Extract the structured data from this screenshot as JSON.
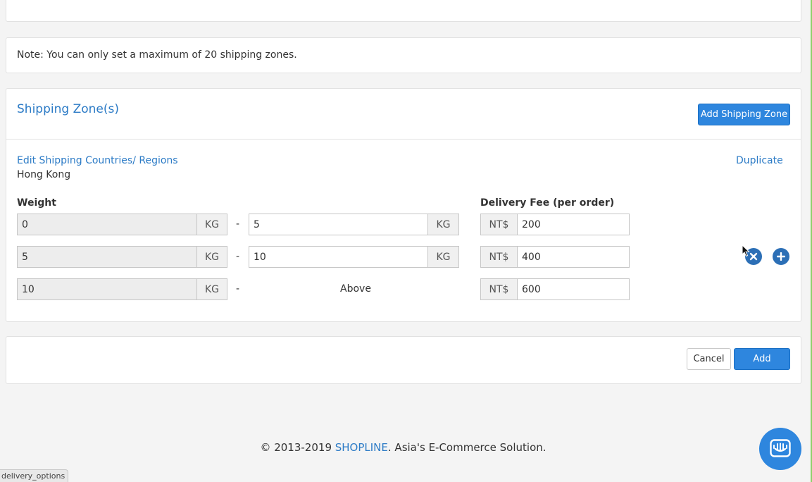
{
  "note": {
    "text": "Note: You can only set a maximum of 20 shipping zones."
  },
  "zones": {
    "title": "Shipping Zone(s)",
    "add_zone_label": "Add Shipping Zone",
    "zone": {
      "edit_link": "Edit Shipping Countries/ Regions",
      "region": "Hong Kong",
      "duplicate_label": "Duplicate",
      "weight_label": "Weight",
      "fee_label": "Delivery Fee (per order)",
      "unit": "KG",
      "dash": "-",
      "currency": "NT$",
      "rows": [
        {
          "from": "0",
          "to": "5",
          "fee": "200"
        },
        {
          "from": "5",
          "to": "10",
          "fee": "400"
        },
        {
          "from": "10",
          "to_text": "Above",
          "fee": "600"
        }
      ]
    }
  },
  "actions": {
    "cancel_label": "Cancel",
    "add_label": "Add"
  },
  "footer": {
    "prefix": "© 2013-2019 ",
    "brand": "SHOPLINE",
    "suffix": ". Asia's E-Commerce Solution."
  },
  "status_bar": {
    "text": "delivery_options"
  },
  "colors": {
    "accent": "#2e86de",
    "link": "#2c7bc6",
    "icon_dark": "#2c6fb6"
  }
}
